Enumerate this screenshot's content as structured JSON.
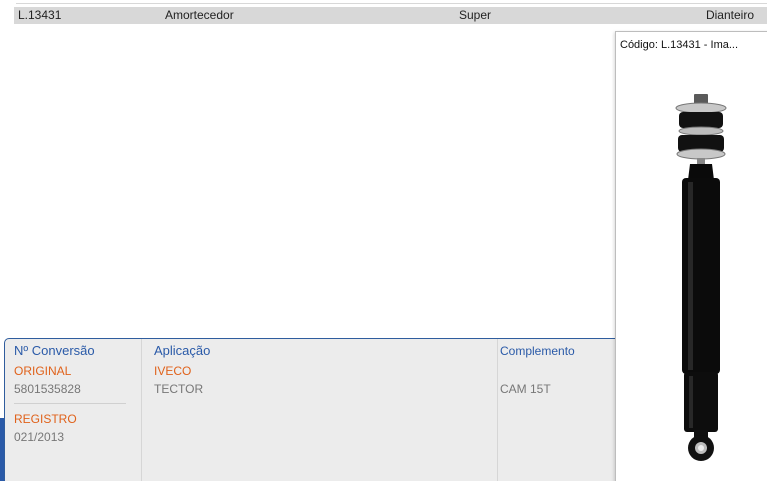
{
  "result": {
    "code": "L.13431",
    "type": "Amortecedor",
    "line": "Super",
    "position": "Dianteiro"
  },
  "details": {
    "conversion": {
      "header": "Nº Conversão",
      "entries": [
        {
          "label": "ORIGINAL",
          "value": "5801535828"
        },
        {
          "label": "REGISTRO",
          "value": "021/2013"
        }
      ]
    },
    "application": {
      "header": "Aplicação",
      "brand": "IVECO",
      "model": "TECTOR"
    },
    "complement": {
      "header": "Complemento",
      "value": "CAM 15T"
    }
  },
  "popup": {
    "title": "Código: L.13431 - Ima..."
  },
  "colors": {
    "header_blue": "#2a5aa8",
    "label_orange": "#e0621b",
    "row_gray": "#d8d8d8",
    "panel_gray": "#ececec"
  },
  "icons": [
    "shock-absorber-image"
  ]
}
